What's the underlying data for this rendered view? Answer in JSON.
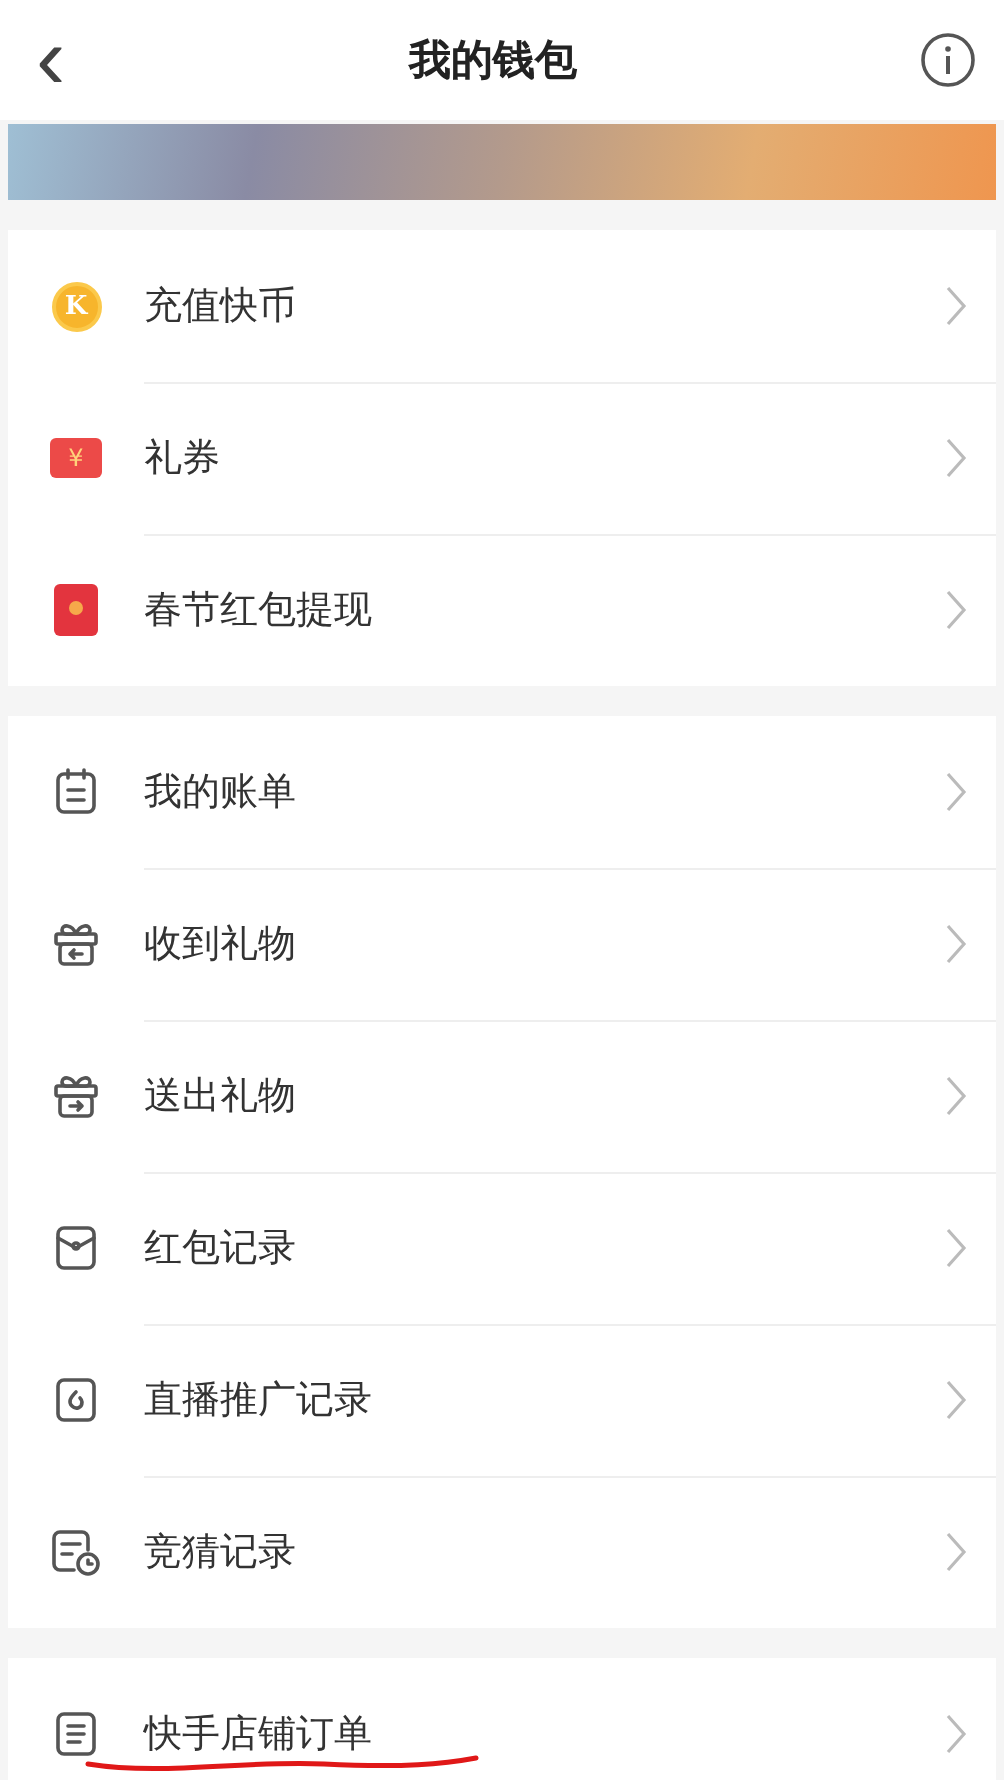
{
  "header": {
    "back": "‹",
    "title": "我的钱包"
  },
  "sections": [
    {
      "items": [
        {
          "kind": "coin",
          "label": "充值快币",
          "icon_text": "K"
        },
        {
          "kind": "ticket",
          "label": "礼券",
          "icon_text": "¥"
        },
        {
          "kind": "redpacket",
          "label": "春节红包提现"
        }
      ]
    },
    {
      "items": [
        {
          "kind": "bill",
          "label": "我的账单"
        },
        {
          "kind": "gift-in",
          "label": "收到礼物"
        },
        {
          "kind": "gift-out",
          "label": "送出礼物"
        },
        {
          "kind": "envelope",
          "label": "红包记录"
        },
        {
          "kind": "live",
          "label": "直播推广记录"
        },
        {
          "kind": "quiz",
          "label": "竞猜记录"
        }
      ]
    },
    {
      "items": [
        {
          "kind": "order",
          "label": "快手店铺订单",
          "underlined": true
        }
      ]
    }
  ]
}
